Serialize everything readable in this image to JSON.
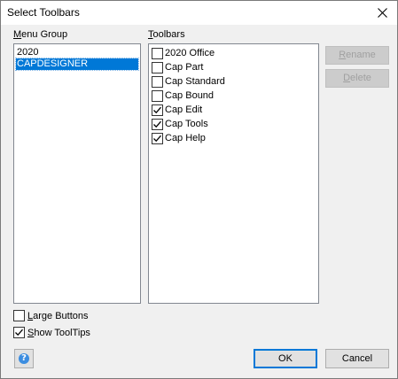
{
  "window": {
    "title": "Select Toolbars"
  },
  "menu_group": {
    "label_mnemonic": "M",
    "label_rest": "enu Group",
    "items": [
      {
        "label": "2020",
        "selected": false
      },
      {
        "label": "CAPDESIGNER",
        "selected": true
      }
    ]
  },
  "toolbars": {
    "label_mnemonic": "T",
    "label_rest": "oolbars",
    "items": [
      {
        "label": "2020 Office",
        "checked": false
      },
      {
        "label": "Cap Part",
        "checked": false
      },
      {
        "label": "Cap Standard",
        "checked": false
      },
      {
        "label": "Cap Bound",
        "checked": false
      },
      {
        "label": "Cap Edit",
        "checked": true
      },
      {
        "label": "Cap Tools",
        "checked": true
      },
      {
        "label": "Cap Help",
        "checked": true
      }
    ]
  },
  "buttons": {
    "rename_mnemonic": "R",
    "rename_rest": "ename",
    "delete_mnemonic": "D",
    "delete_rest": "elete",
    "ok": "OK",
    "cancel": "Cancel"
  },
  "options": {
    "large_buttons_mnemonic": "L",
    "large_buttons_rest": "arge Buttons",
    "large_buttons_checked": false,
    "show_tooltips_mnemonic": "S",
    "show_tooltips_rest": "how ToolTips",
    "show_tooltips_checked": true
  },
  "help": {
    "glyph": "?"
  },
  "colors": {
    "selection": "#0078d7",
    "default_button_border": "#0078d7"
  }
}
